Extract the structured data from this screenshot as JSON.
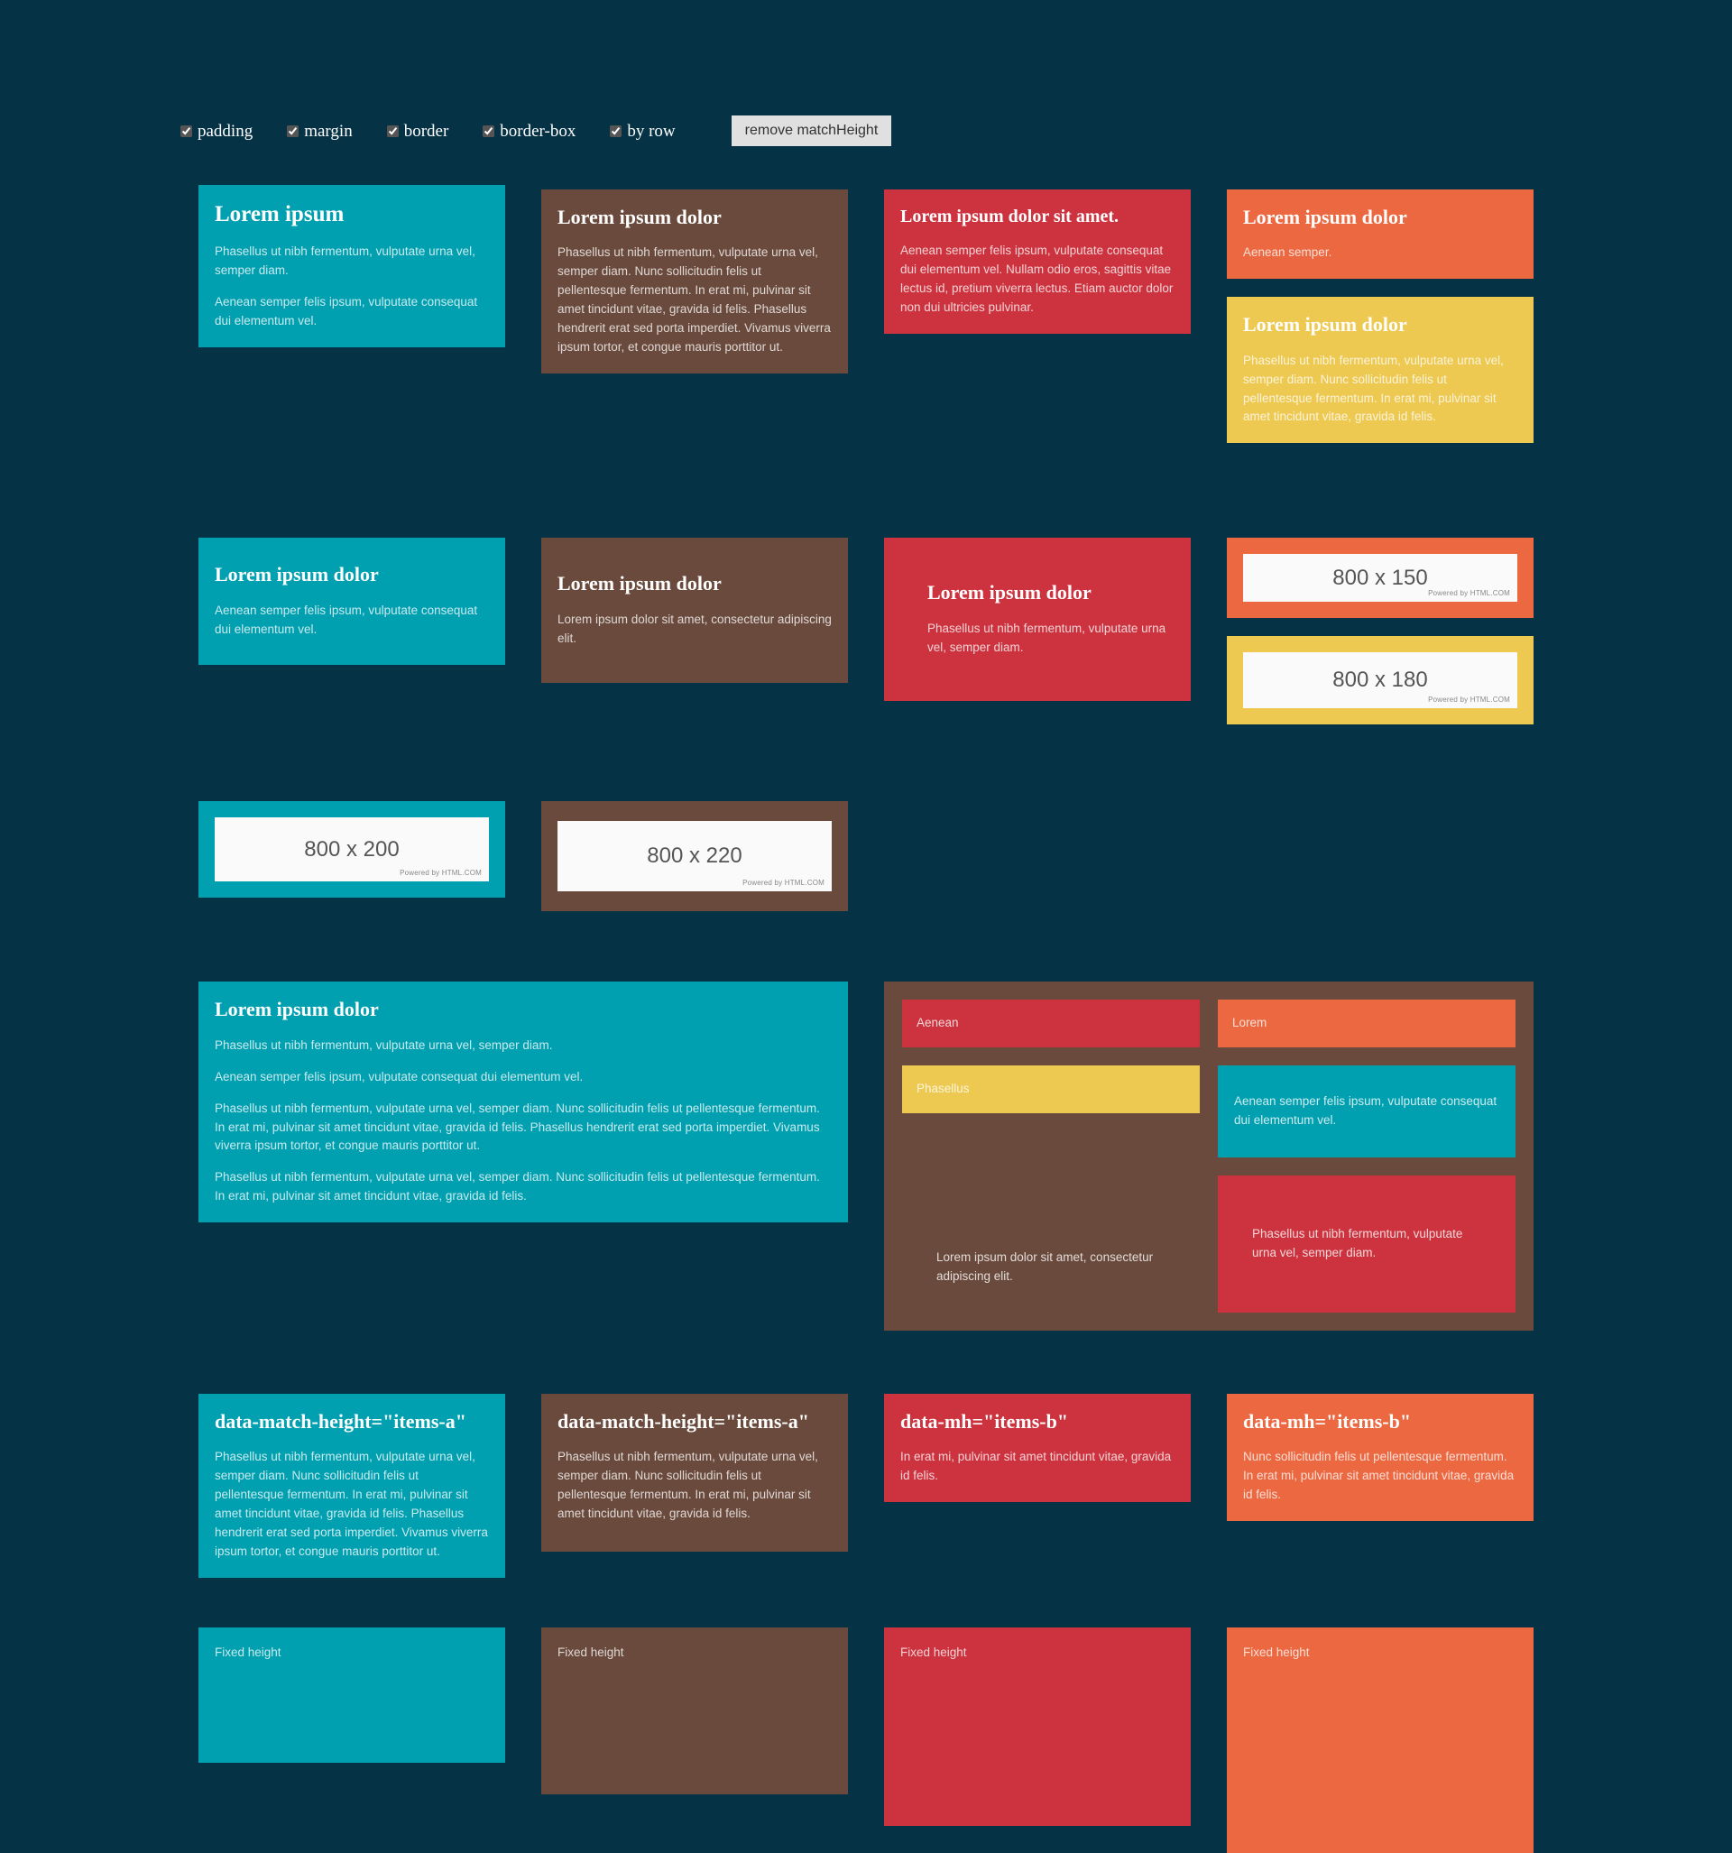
{
  "toolbar": {
    "options": [
      {
        "label": "padding",
        "checked": true
      },
      {
        "label": "margin",
        "checked": true
      },
      {
        "label": "border",
        "checked": true
      },
      {
        "label": "border-box",
        "checked": true
      },
      {
        "label": "by row",
        "checked": true
      }
    ],
    "remove_button": "remove matchHeight"
  },
  "colors": {
    "background": "#063246",
    "teal": "#00a0b0",
    "brown": "#6a4a3c",
    "red": "#cc333f",
    "orange": "#eb6841",
    "yellow": "#edc951",
    "placeholder_bg": "#fafafa"
  },
  "row1": {
    "c1": {
      "heading": "Lorem ipsum",
      "p1": "Phasellus ut nibh fermentum, vulputate urna vel, semper diam.",
      "p2": "Aenean semper felis ipsum, vulputate consequat dui elementum vel."
    },
    "c2": {
      "heading": "Lorem ipsum dolor",
      "p1": "Phasellus ut nibh fermentum, vulputate urna vel, semper diam. Nunc sollicitudin felis ut pellentesque fermentum. In erat mi, pulvinar sit amet tincidunt vitae, gravida id felis. Phasellus hendrerit erat sed porta imperdiet. Vivamus viverra ipsum tortor, et congue mauris porttitor ut."
    },
    "c3": {
      "heading": "Lorem ipsum dolor sit amet.",
      "p1": "Aenean semper felis ipsum, vulputate consequat dui elementum vel. Nullam odio eros, sagittis vitae lectus id, pretium viverra lectus. Etiam auctor dolor non dui ultricies pulvinar."
    },
    "c4a": {
      "heading": "Lorem ipsum dolor",
      "p1": "Aenean semper."
    },
    "c4b": {
      "heading": "Lorem ipsum dolor",
      "p1": "Phasellus ut nibh fermentum, vulputate urna vel, semper diam. Nunc sollicitudin felis ut pellentesque fermentum. In erat mi, pulvinar sit amet tincidunt vitae, gravida id felis."
    }
  },
  "row2": {
    "c1": {
      "heading": "Lorem ipsum dolor",
      "p1": "Aenean semper felis ipsum, vulputate consequat dui elementum vel."
    },
    "c2": {
      "heading": "Lorem ipsum dolor",
      "p1": "Lorem ipsum dolor sit amet, consectetur adipiscing elit."
    },
    "c3": {
      "heading": "Lorem ipsum dolor",
      "p1": "Phasellus ut nibh fermentum, vulputate urna vel, semper diam."
    },
    "c4a": {
      "image_label": "800 x 150",
      "credit": "Powered by HTML.COM"
    },
    "c4b": {
      "image_label": "800 x 180",
      "credit": "Powered by HTML.COM"
    }
  },
  "row3": {
    "c1": {
      "image_label": "800 x 200",
      "credit": "Powered by HTML.COM"
    },
    "c2": {
      "image_label": "800 x 220",
      "credit": "Powered by HTML.COM"
    }
  },
  "row4": {
    "big": {
      "heading": "Lorem ipsum dolor",
      "p1": "Phasellus ut nibh fermentum, vulputate urna vel, semper diam.",
      "p2": "Aenean semper felis ipsum, vulputate consequat dui elementum vel.",
      "p3": "Phasellus ut nibh fermentum, vulputate urna vel, semper diam. Nunc sollicitudin felis ut pellentesque fermentum. In erat mi, pulvinar sit amet tincidunt vitae, gravida id felis. Phasellus hendrerit erat sed porta imperdiet. Vivamus viverra ipsum tortor, et congue mauris porttitor ut.",
      "p4": "Phasellus ut nibh fermentum, vulputate urna vel, semper diam. Nunc sollicitudin felis ut pellentesque fermentum. In erat mi, pulvinar sit amet tincidunt vitae, gravida id felis."
    },
    "nested": {
      "left_1": "Aenean",
      "left_2": "Phasellus",
      "left_3": "Lorem ipsum dolor sit amet, consectetur adipiscing elit.",
      "right_1": "Lorem",
      "right_2": "Aenean semper felis ipsum, vulputate consequat dui elementum vel.",
      "right_3": "Phasellus ut nibh fermentum, vulputate urna vel, semper diam."
    }
  },
  "row5": {
    "c1": {
      "heading": "data-match-height=\"items-a\"",
      "p1": "Phasellus ut nibh fermentum, vulputate urna vel, semper diam. Nunc sollicitudin felis ut pellentesque fermentum. In erat mi, pulvinar sit amet tincidunt vitae, gravida id felis. Phasellus hendrerit erat sed porta imperdiet. Vivamus viverra ipsum tortor, et congue mauris porttitor ut."
    },
    "c2": {
      "heading": "data-match-height=\"items-a\"",
      "p1": "Phasellus ut nibh fermentum, vulputate urna vel, semper diam. Nunc sollicitudin felis ut pellentesque fermentum. In erat mi, pulvinar sit amet tincidunt vitae, gravida id felis."
    },
    "c3": {
      "heading": "data-mh=\"items-b\"",
      "p1": "In erat mi, pulvinar sit amet tincidunt vitae, gravida id felis."
    },
    "c4": {
      "heading": "data-mh=\"items-b\"",
      "p1": "Nunc sollicitudin felis ut pellentesque fermentum. In erat mi, pulvinar sit amet tincidunt vitae, gravida id felis."
    }
  },
  "row6": {
    "c1": {
      "label": "Fixed height"
    },
    "c2": {
      "label": "Fixed height"
    },
    "c3": {
      "label": "Fixed height"
    },
    "c4": {
      "label": "Fixed height"
    }
  }
}
